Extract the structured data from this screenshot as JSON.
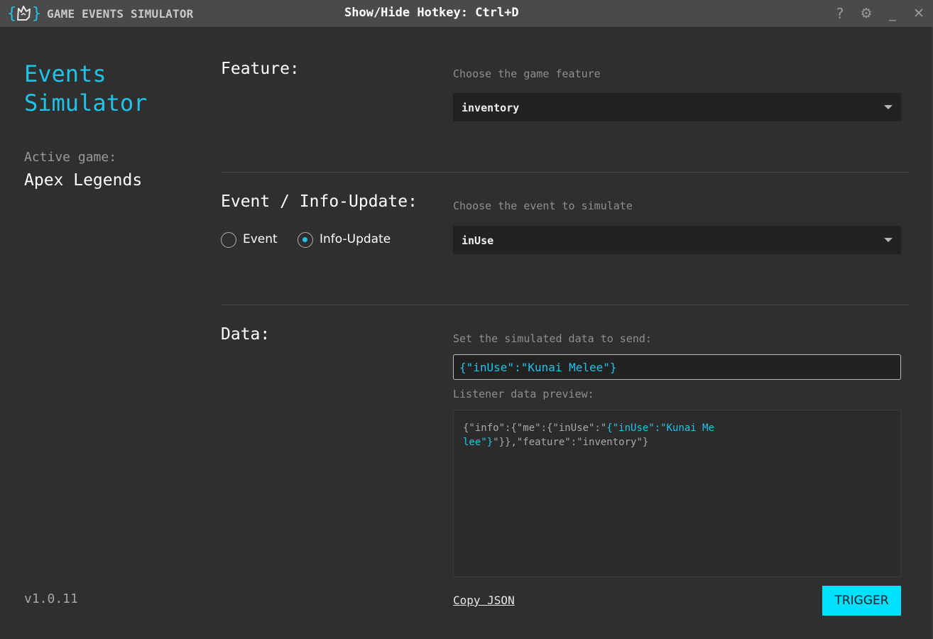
{
  "titlebar": {
    "app_name": "GAME EVENTS SIMULATOR",
    "hotkey_label": "Show/Hide Hotkey:",
    "hotkey_value": "Ctrl+D",
    "icons": [
      "help-icon",
      "gear-icon",
      "minimize-icon",
      "close-icon"
    ],
    "help_glyph": "?",
    "settings_glyph": "⚙",
    "minimize_glyph": "_",
    "close_glyph": "✕"
  },
  "sidebar": {
    "brand_line1": "Events",
    "brand_line2": "Simulator",
    "active_label": "Active game:",
    "active_game": "Apex Legends",
    "version": "v1.0.11"
  },
  "feature": {
    "title": "Feature:",
    "hint": "Choose the game feature",
    "selected": "inventory"
  },
  "event": {
    "title": "Event / Info-Update:",
    "hint": "Choose the event to simulate",
    "selected": "inUse",
    "radio_event": "Event",
    "radio_info": "Info-Update",
    "checked": "Info-Update"
  },
  "data": {
    "title": "Data:",
    "hint": "Set the simulated data to send:",
    "input_value": "{\"inUse\":\"Kunai Melee\"}",
    "preview_label": "Listener data preview:",
    "preview_prefix": "{\"info\":{\"me\":{\"inUse\":\"",
    "preview_highlight": "{\"inUse\":\"Kunai Melee\"}",
    "preview_suffix": "\"}},\"feature\":\"inventory\"}",
    "copy_label": "Copy JSON",
    "trigger_label": "TRIGGER"
  },
  "colors": {
    "accent": "#1ec4e8",
    "button": "#00e0ff",
    "background": "#2f2f2f",
    "titlebar": "#4a4a4a",
    "field": "#222222"
  }
}
